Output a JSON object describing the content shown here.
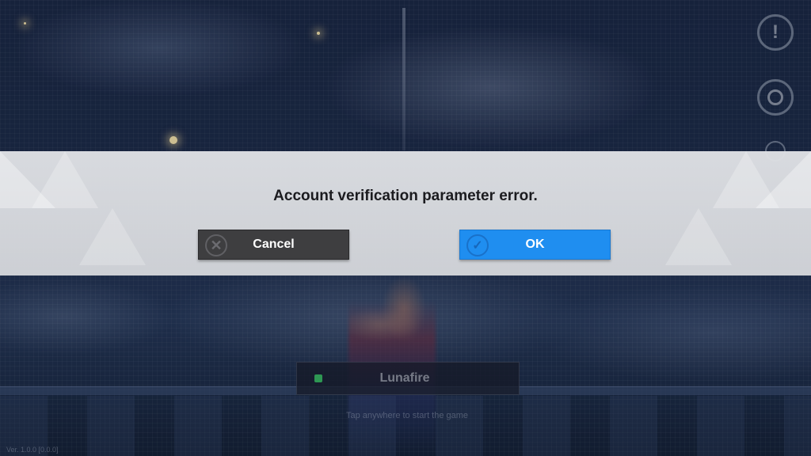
{
  "dialog": {
    "message": "Account verification parameter error.",
    "cancel_label": "Cancel",
    "ok_label": "OK",
    "colors": {
      "band": "#dedfe3",
      "cancel_button": "#3e3e40",
      "ok_button": "#1f8ef0",
      "message_text": "#1b1b1f"
    }
  },
  "icons": {
    "cancel": "close-circle-icon",
    "ok": "check-circle-icon",
    "side_top": "notice-icon",
    "side_middle": "settings-icon",
    "side_bottom": "menu-icon"
  },
  "background": {
    "server_name": "Lunafire",
    "tap_hint": "Tap anywhere to start the game",
    "version": "Ver. 1.0.0 [0.0.0]"
  }
}
